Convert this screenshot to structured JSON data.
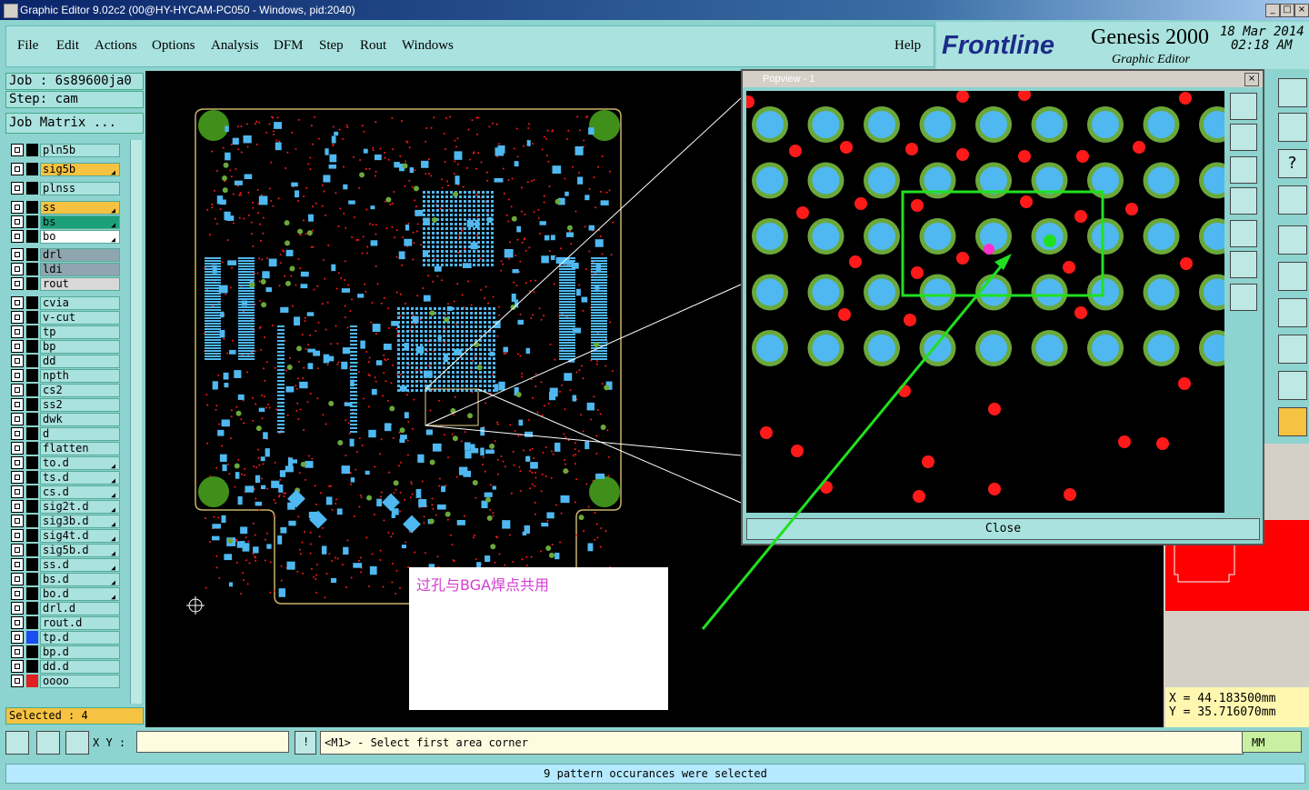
{
  "window": {
    "title": "Graphic Editor 9.02c2 (00@HY-HYCAM-PC050 - Windows, pid:2040)",
    "min": "_",
    "max": "□",
    "close": "×"
  },
  "menu": {
    "items": [
      "File",
      "Edit",
      "Actions",
      "Options",
      "Analysis",
      "DFM",
      "Step",
      "Rout",
      "Windows"
    ],
    "help": "Help"
  },
  "brand": {
    "logo": "Frontline",
    "product": "Genesis 2000",
    "subtitle": "Graphic Editor",
    "date": "18 Mar 2014",
    "time": "02:18 AM"
  },
  "job": {
    "job_label": "Job : 6s89600ja0",
    "step_label": "Step: cam",
    "matrix_button": "Job Matrix ..."
  },
  "layers": [
    {
      "name": "pln5b",
      "color": "#000000",
      "bg": "#a9e2de",
      "arrow": false
    },
    {
      "name": "sig5b",
      "color": "#000000",
      "bg": "#f5c242",
      "arrow": true
    },
    {
      "name": "plnss",
      "color": "#000000",
      "bg": "#a9e2de",
      "arrow": false
    },
    {
      "name": "ss",
      "color": "#000000",
      "bg": "#f5c242",
      "arrow": true
    },
    {
      "name": "bs",
      "color": "#000000",
      "bg": "#1ca07a",
      "arrow": true
    },
    {
      "name": "bo",
      "color": "#000000",
      "bg": "#ffffff",
      "arrow": true
    },
    {
      "name": "drl",
      "color": "#000000",
      "bg": "#8fa6b0",
      "arrow": false
    },
    {
      "name": "ldi",
      "color": "#000000",
      "bg": "#8fa6b0",
      "arrow": false
    },
    {
      "name": "rout",
      "color": "#000000",
      "bg": "#d8d8d8",
      "arrow": false
    },
    {
      "name": "cvia",
      "color": "#000000",
      "bg": "#a9e2de",
      "arrow": false
    },
    {
      "name": "v-cut",
      "color": "#000000",
      "bg": "#a9e2de",
      "arrow": false
    },
    {
      "name": "tp",
      "color": "#000000",
      "bg": "#a9e2de",
      "arrow": false
    },
    {
      "name": "bp",
      "color": "#000000",
      "bg": "#a9e2de",
      "arrow": false
    },
    {
      "name": "dd",
      "color": "#000000",
      "bg": "#a9e2de",
      "arrow": false
    },
    {
      "name": "npth",
      "color": "#000000",
      "bg": "#a9e2de",
      "arrow": false
    },
    {
      "name": "cs2",
      "color": "#000000",
      "bg": "#a9e2de",
      "arrow": false
    },
    {
      "name": "ss2",
      "color": "#000000",
      "bg": "#a9e2de",
      "arrow": false
    },
    {
      "name": "dwk",
      "color": "#000000",
      "bg": "#a9e2de",
      "arrow": false
    },
    {
      "name": "d",
      "color": "#000000",
      "bg": "#a9e2de",
      "arrow": false
    },
    {
      "name": "flatten",
      "color": "#000000",
      "bg": "#a9e2de",
      "arrow": false
    },
    {
      "name": "to.d",
      "color": "#000000",
      "bg": "#a9e2de",
      "arrow": true
    },
    {
      "name": "ts.d",
      "color": "#000000",
      "bg": "#a9e2de",
      "arrow": true
    },
    {
      "name": "cs.d",
      "color": "#000000",
      "bg": "#a9e2de",
      "arrow": true
    },
    {
      "name": "sig2t.d",
      "color": "#000000",
      "bg": "#a9e2de",
      "arrow": true
    },
    {
      "name": "sig3b.d",
      "color": "#000000",
      "bg": "#a9e2de",
      "arrow": true
    },
    {
      "name": "sig4t.d",
      "color": "#000000",
      "bg": "#a9e2de",
      "arrow": true
    },
    {
      "name": "sig5b.d",
      "color": "#000000",
      "bg": "#a9e2de",
      "arrow": true
    },
    {
      "name": "ss.d",
      "color": "#000000",
      "bg": "#a9e2de",
      "arrow": true
    },
    {
      "name": "bs.d",
      "color": "#000000",
      "bg": "#a9e2de",
      "arrow": true
    },
    {
      "name": "bo.d",
      "color": "#000000",
      "bg": "#a9e2de",
      "arrow": true
    },
    {
      "name": "drl.d",
      "color": "#000000",
      "bg": "#a9e2de",
      "arrow": false
    },
    {
      "name": "rout.d",
      "color": "#000000",
      "bg": "#a9e2de",
      "arrow": false
    },
    {
      "name": "tp.d",
      "color": "#1a4cf0",
      "bg": "#a9e2de",
      "arrow": false
    },
    {
      "name": "bp.d",
      "color": "#000000",
      "bg": "#a9e2de",
      "arrow": false
    },
    {
      "name": "dd.d",
      "color": "#000000",
      "bg": "#a9e2de",
      "arrow": false
    },
    {
      "name": "oooo",
      "color": "#e02020",
      "bg": "#a9e2de",
      "arrow": false
    }
  ],
  "selected": "Selected : 4",
  "popview": {
    "title": "Popview - 1",
    "close_label": "Close",
    "close_x": "×"
  },
  "note": {
    "text": "过孔与BGA焊点共用"
  },
  "coords": {
    "x": "X = 44.183500mm",
    "y": "Y = 35.716070mm"
  },
  "bottom": {
    "xy_label": "X Y :",
    "xy_value": "",
    "prompt": "<M1> - Select first area corner",
    "units": "MM"
  },
  "status": "9 pattern occurances were selected",
  "colors": {
    "pad": "#4fb8f0",
    "ring": "#6aa83a",
    "via": "#ff1a1a",
    "select": "#20e020",
    "panel": "#8dd3cf"
  }
}
